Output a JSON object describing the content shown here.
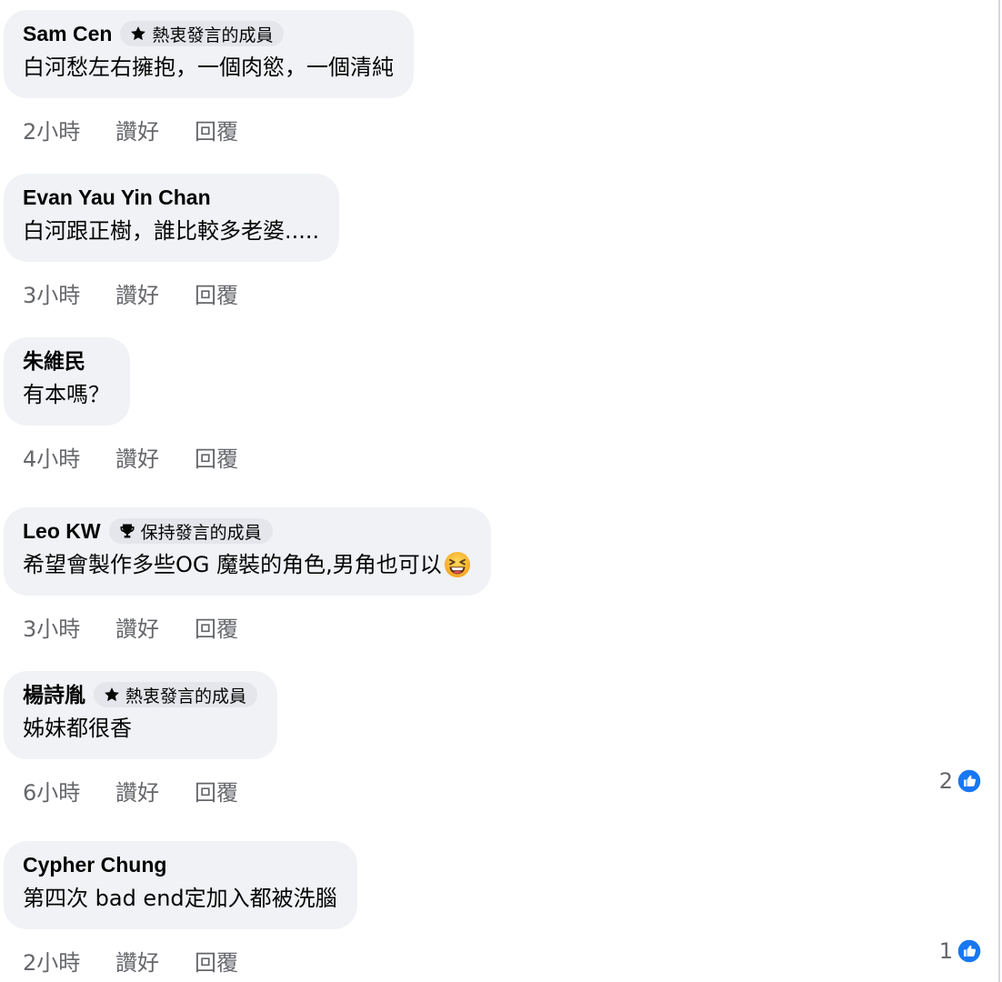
{
  "colors": {
    "bubble_bg": "#f0f2f5",
    "badge_bg": "#e4e6eb",
    "meta_text": "#65676b",
    "like_blue": "#1877f2"
  },
  "actions": {
    "like_label": "讚好",
    "reply_label": "回覆"
  },
  "comments": [
    {
      "author": "Sam Cen",
      "badge": {
        "icon": "star-icon",
        "label": "熱衷發言的成員"
      },
      "text": "白河愁左右擁抱，一個肉慾，一個清純",
      "time": "2小時",
      "reaction_count": null
    },
    {
      "author": "Evan Yau Yin Chan",
      "badge": null,
      "text": "白河跟正樹，誰比較多老婆.....",
      "time": "3小時",
      "reaction_count": null
    },
    {
      "author": "朱維民",
      "badge": null,
      "text": "有本嗎？",
      "time": "4小時",
      "reaction_count": null
    },
    {
      "author": "Leo KW",
      "badge": {
        "icon": "trophy-icon",
        "label": "保持發言的成員"
      },
      "text": "希望會製作多些OG 魔裝的角色,男角也可以",
      "emoji": "laughing-face-emoji",
      "time": "3小時",
      "reaction_count": null
    },
    {
      "author": "楊詩胤",
      "badge": {
        "icon": "star-icon",
        "label": "熱衷發言的成員"
      },
      "text": "姊妹都很香",
      "time": "6小時",
      "reaction_count": "2"
    },
    {
      "author": "Cypher Chung",
      "badge": null,
      "text": "第四次 bad end定加入都被洗腦",
      "time": "2小時",
      "reaction_count": "1"
    }
  ]
}
